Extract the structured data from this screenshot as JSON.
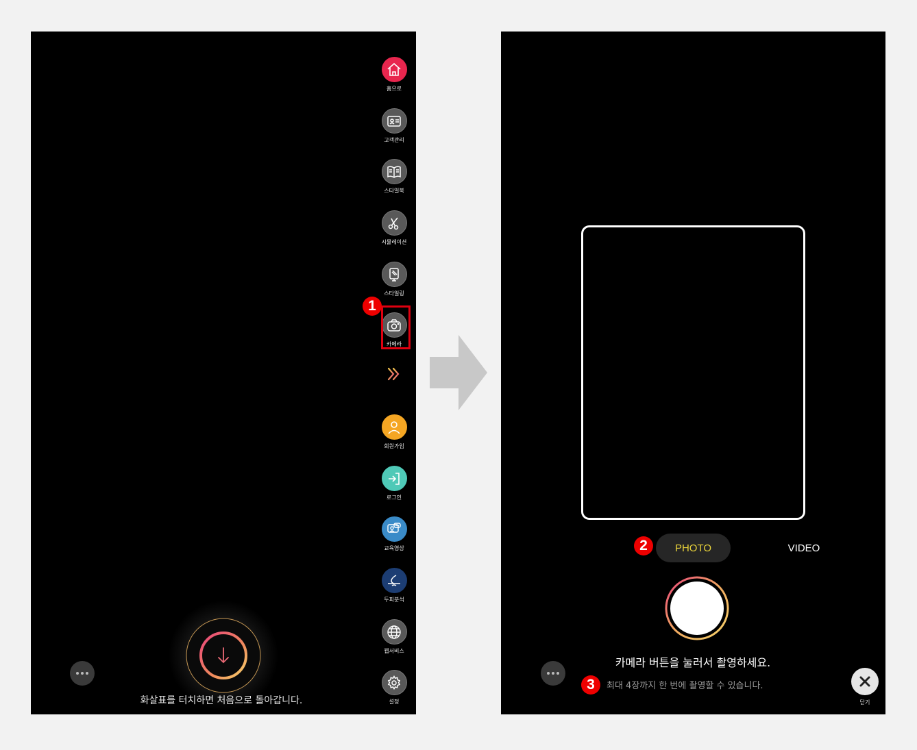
{
  "left": {
    "sidebar": [
      {
        "key": "home",
        "label": "홈으로",
        "color": "#e8264e",
        "icon": "home-icon"
      },
      {
        "key": "customer",
        "label": "고객관리",
        "color": "#595959",
        "icon": "id-card-icon"
      },
      {
        "key": "stylebook",
        "label": "스타일북",
        "color": "#595959",
        "icon": "book-icon"
      },
      {
        "key": "simulation",
        "label": "시뮬레이션",
        "color": "#595959",
        "icon": "scissors-icon"
      },
      {
        "key": "styling",
        "label": "스타일링",
        "color": "#595959",
        "icon": "mirror-icon"
      },
      {
        "key": "camera",
        "label": "카메라",
        "color": "#595959",
        "icon": "camera-icon"
      },
      {
        "key": "signup",
        "label": "회원가입",
        "color": "#f5a623",
        "icon": "person-icon"
      },
      {
        "key": "login",
        "label": "로그인",
        "color": "#4fc9b7",
        "icon": "login-icon"
      },
      {
        "key": "education",
        "label": "교육영상",
        "color": "#3a8bc8",
        "icon": "chat-video-icon"
      },
      {
        "key": "scalp",
        "label": "두피분석",
        "color": "#1c3d73",
        "icon": "drop-icon"
      },
      {
        "key": "web",
        "label": "웹서비스",
        "color": "#595959",
        "icon": "globe-icon"
      },
      {
        "key": "settings",
        "label": "설정",
        "color": "#595959",
        "icon": "gear-icon"
      }
    ],
    "guide_text": "화살표를 터치하면 처음으로 돌아갑니다.",
    "badge": "1"
  },
  "right": {
    "mode_photo": "PHOTO",
    "mode_video": "VIDEO",
    "instruction": "카메라 버튼을 눌러서 촬영하세요.",
    "sub_instruction": "최대 4장까지 한 번에 촬영할 수 있습니다.",
    "close_label": "닫기",
    "badge2": "2",
    "badge3": "3"
  },
  "colors": {
    "accent": "#e8d23a",
    "highlight": "#e00010"
  }
}
